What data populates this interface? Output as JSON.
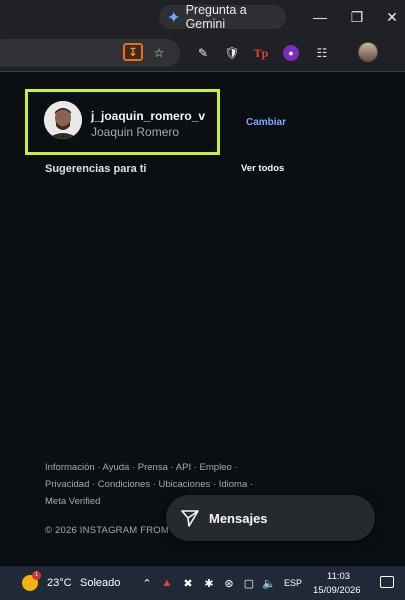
{
  "browser": {
    "gemini_button": "Pregunta a Gemini",
    "window_controls": [
      "minimize",
      "restore",
      "close"
    ]
  },
  "profile": {
    "username": "j_joaquin_romero_v",
    "full_name": "Joaquin Romero",
    "switch_label": "Cambiar"
  },
  "suggestions": {
    "title": "Sugerencias para ti",
    "see_all": "Ver todos"
  },
  "footer": {
    "line1": "Información · Ayuda · Prensa · API · Empleo ·",
    "line2": "Privacidad · Condiciones · Ubicaciones · Idioma ·",
    "line3": "Meta Verified",
    "copyright": "© 2026 INSTAGRAM FROM META"
  },
  "messages": {
    "label": "Mensajes"
  },
  "taskbar": {
    "weather_badge": "1",
    "temperature": "23°C",
    "weather": "Soleado",
    "language": "ESP",
    "time": "11:03",
    "date": "15/09/2026"
  },
  "colors": {
    "highlight_border": "#c6f432",
    "link": "#7aa8ff",
    "background": "#0b0f14"
  }
}
